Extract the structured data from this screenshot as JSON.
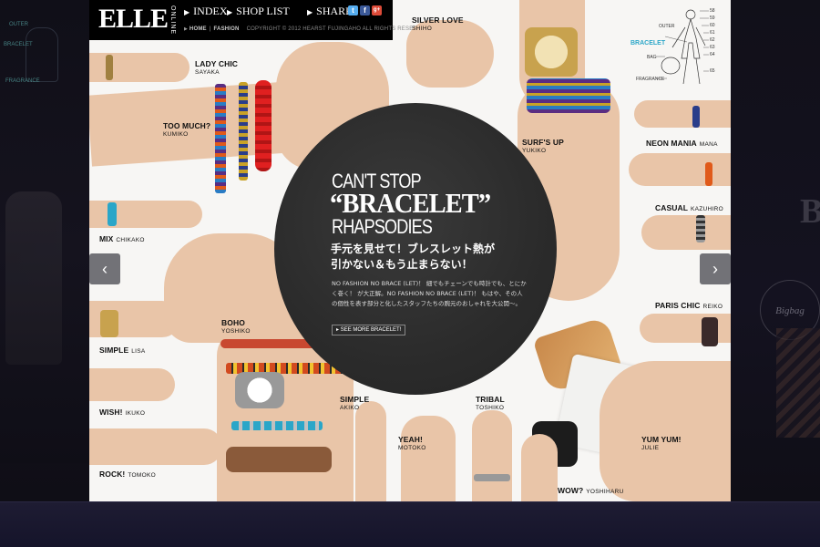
{
  "header": {
    "logo": "ELLE",
    "logo_sub": "ONLINE",
    "nav_index": "INDEX",
    "nav_shop": "SHOP LIST",
    "nav_share": "SHARE",
    "share_buttons": {
      "twitter": "t",
      "facebook": "f",
      "google": "g+"
    },
    "breadcrumb_home": "HOME",
    "breadcrumb_fashion": "FASHION",
    "copyright": "COPYRIGHT © 2012 HEARST FUJINGAHO ALL RIGHTS RESERVED."
  },
  "feature": {
    "headline_1": "CAN'T STOP",
    "headline_2": "“BRACELET”",
    "headline_3": "RHAPSODIES",
    "subhead_jp": "手元を見せて！ブレスレット熱が引かない＆もう止まらない！",
    "body_jp": "NO FASHION NO BRACE (LET)！ 細でもチェーンでも時計でも、とにかく巻く！ が大正解。NO FASHION NO BRACE (LET)！ もはや、その人の個性を表す部分と化したスタッフたちの腕元のおしゃれを大公開〜。",
    "see_more": "SEE MORE BRACELET!"
  },
  "fashion_index": {
    "active": "BRACELET",
    "items": [
      "OUTER",
      "BAG",
      "FRAGRANCE"
    ],
    "numbers": [
      "58",
      "59",
      "60",
      "61",
      "62",
      "63",
      "64",
      "65"
    ]
  },
  "side_left_ghost": {
    "outer": "OUTER",
    "bracelet": "BRACELET",
    "fragrance": "FRAGRANCE"
  },
  "side_right_ghost": {
    "letter": "B",
    "bigbag": "Bigbag"
  },
  "labels": [
    {
      "id": "lady-chic",
      "name": "LADY CHIC",
      "who": "SAYAKA"
    },
    {
      "id": "too-much",
      "name": "TOO MUCH?",
      "who": "KUMIKO"
    },
    {
      "id": "mix",
      "name": "MIX",
      "who": "CHIKAKO"
    },
    {
      "id": "boho",
      "name": "BOHO",
      "who": "YOSHIKO"
    },
    {
      "id": "simple-lisa",
      "name": "SIMPLE",
      "who": "LISA"
    },
    {
      "id": "wish",
      "name": "WISH!",
      "who": "IKUKO"
    },
    {
      "id": "rock",
      "name": "ROCK!",
      "who": "TOMOKO"
    },
    {
      "id": "silver-love",
      "name": "SILVER LOVE",
      "who": "SHIHO"
    },
    {
      "id": "surfs-up",
      "name": "SURF'S UP",
      "who": "YUKIKO"
    },
    {
      "id": "neon-mania",
      "name": "NEON MANIA",
      "who": "MANA"
    },
    {
      "id": "casual",
      "name": "CASUAL",
      "who": "KAZUHIRO"
    },
    {
      "id": "paris-chic",
      "name": "PARIS CHIC",
      "who": "REIKO"
    },
    {
      "id": "simple-akiko",
      "name": "SIMPLE",
      "who": "AKIKO"
    },
    {
      "id": "yeah",
      "name": "YEAH!",
      "who": "MOTOKO"
    },
    {
      "id": "tribal",
      "name": "TRIBAL",
      "who": "TOSHIKO"
    },
    {
      "id": "yum-yum",
      "name": "YUM YUM!",
      "who": "JULIE"
    },
    {
      "id": "wow",
      "name": "WOW?",
      "who": "YOSHIHARU"
    }
  ],
  "arrows": {
    "prev": "‹",
    "next": "›"
  },
  "colors": {
    "page_bg": "#f7f6f4",
    "circle": "#2b2b2b",
    "accent_index": "#2aa6c8",
    "header_bg": "#000000"
  }
}
